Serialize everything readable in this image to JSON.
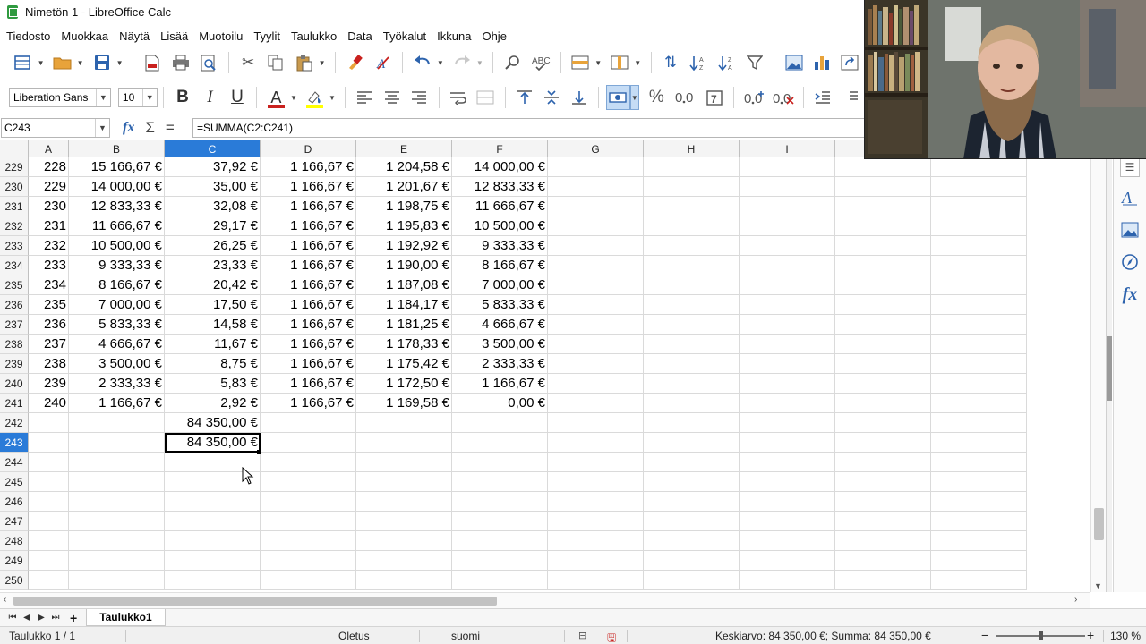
{
  "window": {
    "title": "Nimetön 1 - LibreOffice Calc"
  },
  "menu": [
    "Tiedosto",
    "Muokkaa",
    "Näytä",
    "Lisää",
    "Muotoilu",
    "Tyylit",
    "Taulukko",
    "Data",
    "Työkalut",
    "Ikkuna",
    "Ohje"
  ],
  "formatting": {
    "font_name": "Liberation Sans",
    "font_size": "10",
    "currency_format": "%",
    "decimal_format": "0.0",
    "add_decimal": "0.0",
    "remove_decimal": "0.0"
  },
  "formula_bar": {
    "cell_ref": "C243",
    "formula": "=SUMMA(C2:C241)"
  },
  "columns": [
    "A",
    "B",
    "C",
    "D",
    "E",
    "F",
    "G",
    "H",
    "I"
  ],
  "selected_column": "C",
  "rows": [
    {
      "num": "229",
      "cells": [
        "228",
        "15 166,67 €",
        "37,92 €",
        "1 166,67 €",
        "1 204,58 €",
        "14 000,00 €"
      ]
    },
    {
      "num": "230",
      "cells": [
        "229",
        "14 000,00 €",
        "35,00 €",
        "1 166,67 €",
        "1 201,67 €",
        "12 833,33 €"
      ]
    },
    {
      "num": "231",
      "cells": [
        "230",
        "12 833,33 €",
        "32,08 €",
        "1 166,67 €",
        "1 198,75 €",
        "11 666,67 €"
      ]
    },
    {
      "num": "232",
      "cells": [
        "231",
        "11 666,67 €",
        "29,17 €",
        "1 166,67 €",
        "1 195,83 €",
        "10 500,00 €"
      ]
    },
    {
      "num": "233",
      "cells": [
        "232",
        "10 500,00 €",
        "26,25 €",
        "1 166,67 €",
        "1 192,92 €",
        "9 333,33 €"
      ]
    },
    {
      "num": "234",
      "cells": [
        "233",
        "9 333,33 €",
        "23,33 €",
        "1 166,67 €",
        "1 190,00 €",
        "8 166,67 €"
      ]
    },
    {
      "num": "235",
      "cells": [
        "234",
        "8 166,67 €",
        "20,42 €",
        "1 166,67 €",
        "1 187,08 €",
        "7 000,00 €"
      ]
    },
    {
      "num": "236",
      "cells": [
        "235",
        "7 000,00 €",
        "17,50 €",
        "1 166,67 €",
        "1 184,17 €",
        "5 833,33 €"
      ]
    },
    {
      "num": "237",
      "cells": [
        "236",
        "5 833,33 €",
        "14,58 €",
        "1 166,67 €",
        "1 181,25 €",
        "4 666,67 €"
      ]
    },
    {
      "num": "238",
      "cells": [
        "237",
        "4 666,67 €",
        "11,67 €",
        "1 166,67 €",
        "1 178,33 €",
        "3 500,00 €"
      ]
    },
    {
      "num": "239",
      "cells": [
        "238",
        "3 500,00 €",
        "8,75 €",
        "1 166,67 €",
        "1 175,42 €",
        "2 333,33 €"
      ]
    },
    {
      "num": "240",
      "cells": [
        "239",
        "2 333,33 €",
        "5,83 €",
        "1 166,67 €",
        "1 172,50 €",
        "1 166,67 €"
      ]
    },
    {
      "num": "241",
      "cells": [
        "240",
        "1 166,67 €",
        "2,92 €",
        "1 166,67 €",
        "1 169,58 €",
        "0,00 €"
      ]
    },
    {
      "num": "242",
      "cells": [
        "",
        "",
        "84 350,00 €",
        "",
        "",
        ""
      ]
    },
    {
      "num": "243",
      "cells": [
        "",
        "",
        "84 350,00 €",
        "",
        "",
        ""
      ]
    },
    {
      "num": "244",
      "cells": [
        "",
        "",
        "",
        "",
        "",
        ""
      ]
    },
    {
      "num": "245",
      "cells": [
        "",
        "",
        "",
        "",
        "",
        ""
      ]
    },
    {
      "num": "246",
      "cells": [
        "",
        "",
        "",
        "",
        "",
        ""
      ]
    },
    {
      "num": "247",
      "cells": [
        "",
        "",
        "",
        "",
        "",
        ""
      ]
    },
    {
      "num": "248",
      "cells": [
        "",
        "",
        "",
        "",
        "",
        ""
      ]
    },
    {
      "num": "249",
      "cells": [
        "",
        "",
        "",
        "",
        "",
        ""
      ]
    },
    {
      "num": "250",
      "cells": [
        "",
        "",
        "",
        "",
        "",
        ""
      ]
    }
  ],
  "selected_row": "243",
  "sheet_tab": "Taulukko1",
  "status": {
    "sheet": "Taulukko 1 / 1",
    "page_style": "Oletus",
    "language": "suomi",
    "selection_summary": "Keskiarvo: 84 350,00 €; Summa: 84 350,00 €",
    "zoom": "130 %"
  },
  "colors": {
    "selection_blue": "#2a7bd8",
    "icon_blue": "#2d63ad"
  }
}
